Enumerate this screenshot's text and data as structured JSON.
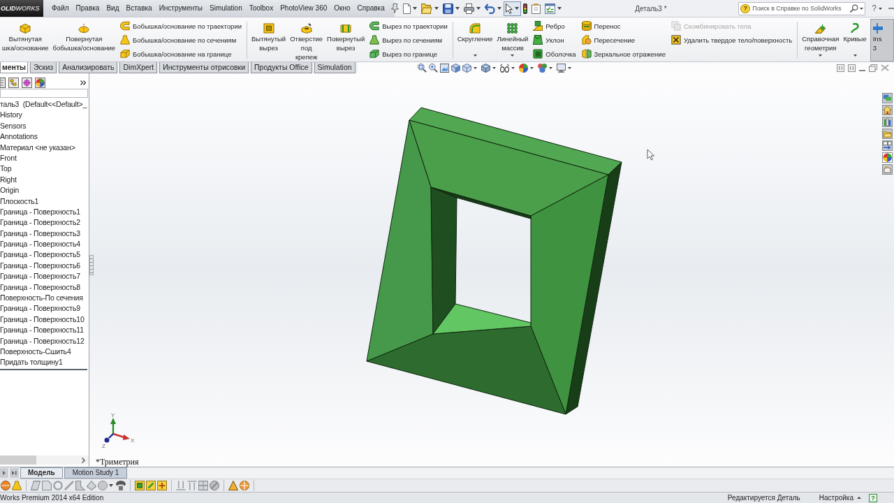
{
  "app_bar": {
    "logo": "**OLID**WORKS",
    "menu": [
      "Файл",
      "Правка",
      "Вид",
      "Вставка",
      "Инструменты",
      "Simulation",
      "Toolbox",
      "PhotoView 360",
      "Окно",
      "Справка"
    ],
    "document_title": "Деталь3 *",
    "help_search": {
      "badge": "?",
      "placeholder": "Поиск в Справке по SolidWorks"
    },
    "help_button": "?"
  },
  "quick_access": [
    {
      "kind": "new",
      "dropdown": true,
      "pressed": false
    },
    {
      "kind": "open",
      "dropdown": true,
      "pressed": false
    },
    {
      "kind": "save",
      "dropdown": true,
      "pressed": false
    },
    {
      "kind": "print",
      "dropdown": true,
      "pressed": false
    },
    {
      "kind": "undo",
      "dropdown": true,
      "pressed": false
    },
    {
      "kind": "select",
      "dropdown": true,
      "pressed": true
    },
    {
      "kind": "rebuild",
      "dropdown": false,
      "pressed": false
    },
    {
      "kind": "properties",
      "dropdown": false,
      "pressed": false
    },
    {
      "kind": "options",
      "dropdown": true,
      "pressed": false
    }
  ],
  "ribbon": [
    {
      "items": [
        {
          "kind": "large",
          "lines": [
            "Вытянутая",
            "шка/основание"
          ],
          "dropdown": false,
          "pressed": false
        },
        {
          "kind": "large",
          "lines": [
            "Повернутая",
            "бобышка/основание"
          ],
          "dropdown": false,
          "pressed": false
        },
        {
          "kind": "column",
          "entries": [
            {
              "label": "Бобышка/основание по траектории",
              "disabled": false
            },
            {
              "label": "Бобышка/основание по сечениям",
              "disabled": false
            },
            {
              "label": "Бобышка/основание на границе",
              "disabled": false
            }
          ]
        }
      ]
    },
    {
      "items": [
        {
          "kind": "large",
          "lines": [
            "Вытянутый",
            "вырез"
          ],
          "dropdown": false,
          "pressed": false
        },
        {
          "kind": "large",
          "lines": [
            "Отверстие",
            "под",
            "крепеж"
          ],
          "dropdown": false,
          "pressed": false
        },
        {
          "kind": "large",
          "lines": [
            "Повернутый",
            "вырез"
          ],
          "dropdown": false,
          "pressed": false
        },
        {
          "kind": "column",
          "entries": [
            {
              "label": "Вырез по траектории",
              "disabled": false
            },
            {
              "label": "Вырез по сечениям",
              "disabled": false
            },
            {
              "label": "Вырез по границе",
              "disabled": false
            }
          ]
        }
      ]
    },
    {
      "items": [
        {
          "kind": "large",
          "lines": [
            "Скругление"
          ],
          "dropdown": true,
          "pressed": false
        },
        {
          "kind": "large",
          "lines": [
            "Линейный",
            "массив"
          ],
          "dropdown": true,
          "pressed": false
        },
        {
          "kind": "column",
          "entries": [
            {
              "label": "Ребро",
              "disabled": false
            },
            {
              "label": "Уклон",
              "disabled": false
            },
            {
              "label": "Оболочка",
              "disabled": false
            }
          ]
        },
        {
          "kind": "column",
          "entries": [
            {
              "label": "Перенос",
              "disabled": false
            },
            {
              "label": "Пересечение",
              "disabled": false
            },
            {
              "label": "Зеркальное отражение",
              "disabled": false
            }
          ]
        },
        {
          "kind": "column",
          "entries": [
            {
              "label": "Скомбинировать тела",
              "disabled": true
            },
            {
              "label": "Удалить твердое тело/поверхность",
              "disabled": false
            }
          ]
        }
      ]
    },
    {
      "items": [
        {
          "kind": "large",
          "lines": [
            "Справочная",
            "геометрия"
          ],
          "dropdown": true,
          "pressed": false
        },
        {
          "kind": "large",
          "lines": [
            "Кривые"
          ],
          "dropdown": true,
          "pressed": false
        },
        {
          "kind": "large",
          "lines": [
            "Ins",
            "3"
          ],
          "dropdown": false,
          "pressed": true
        }
      ]
    }
  ],
  "command_tabs": [
    {
      "label": "менты",
      "selected": true
    },
    {
      "label": "Эскиз",
      "selected": false
    },
    {
      "label": "Анализировать",
      "selected": false
    },
    {
      "label": "DimXpert",
      "selected": false
    },
    {
      "label": "Инструменты отрисовки",
      "selected": false
    },
    {
      "label": "Продукты Office",
      "selected": false
    },
    {
      "label": "Simulation",
      "selected": false
    }
  ],
  "feature_tree": {
    "label": "таль3  (Default<<Default>_",
    "children": [
      {
        "label": "History"
      },
      {
        "label": "Sensors"
      },
      {
        "label": "Annotations"
      },
      {
        "label": "Материал <не указан>"
      },
      {
        "label": "Front"
      },
      {
        "label": "Top"
      },
      {
        "label": "Right"
      },
      {
        "label": "Origin"
      },
      {
        "label": "Плоскость1"
      },
      {
        "label": "Граница - Поверхность1"
      },
      {
        "label": "Граница - Поверхность2"
      },
      {
        "label": "Граница - Поверхность3"
      },
      {
        "label": "Граница - Поверхность4"
      },
      {
        "label": "Граница - Поверхность5"
      },
      {
        "label": "Граница - Поверхность6"
      },
      {
        "label": "Граница - Поверхность7"
      },
      {
        "label": "Граница - Поверхность8"
      },
      {
        "label": "Поверхность-По сечения"
      },
      {
        "label": "Граница - Поверхность9"
      },
      {
        "label": "Граница - Поверхность10"
      },
      {
        "label": "Граница - Поверхность11"
      },
      {
        "label": "Граница - Поверхность12"
      },
      {
        "label": "Поверхность-Сшить4"
      },
      {
        "label": "Придать толщину1"
      }
    ]
  },
  "viewport": {
    "view_name": "*Триметрия",
    "triad": {
      "x_label": "X",
      "y_label": "Y",
      "z_label": "Z"
    }
  },
  "bottom_tabs": [
    {
      "label": "Модель",
      "selected": true
    },
    {
      "label": "Motion Study 1",
      "selected": false
    }
  ],
  "status_bar": {
    "edition": "Works Premium 2014 x64 Edition",
    "mode": "Редактируется Деталь",
    "units": "Настройка",
    "help_badge": "?"
  }
}
